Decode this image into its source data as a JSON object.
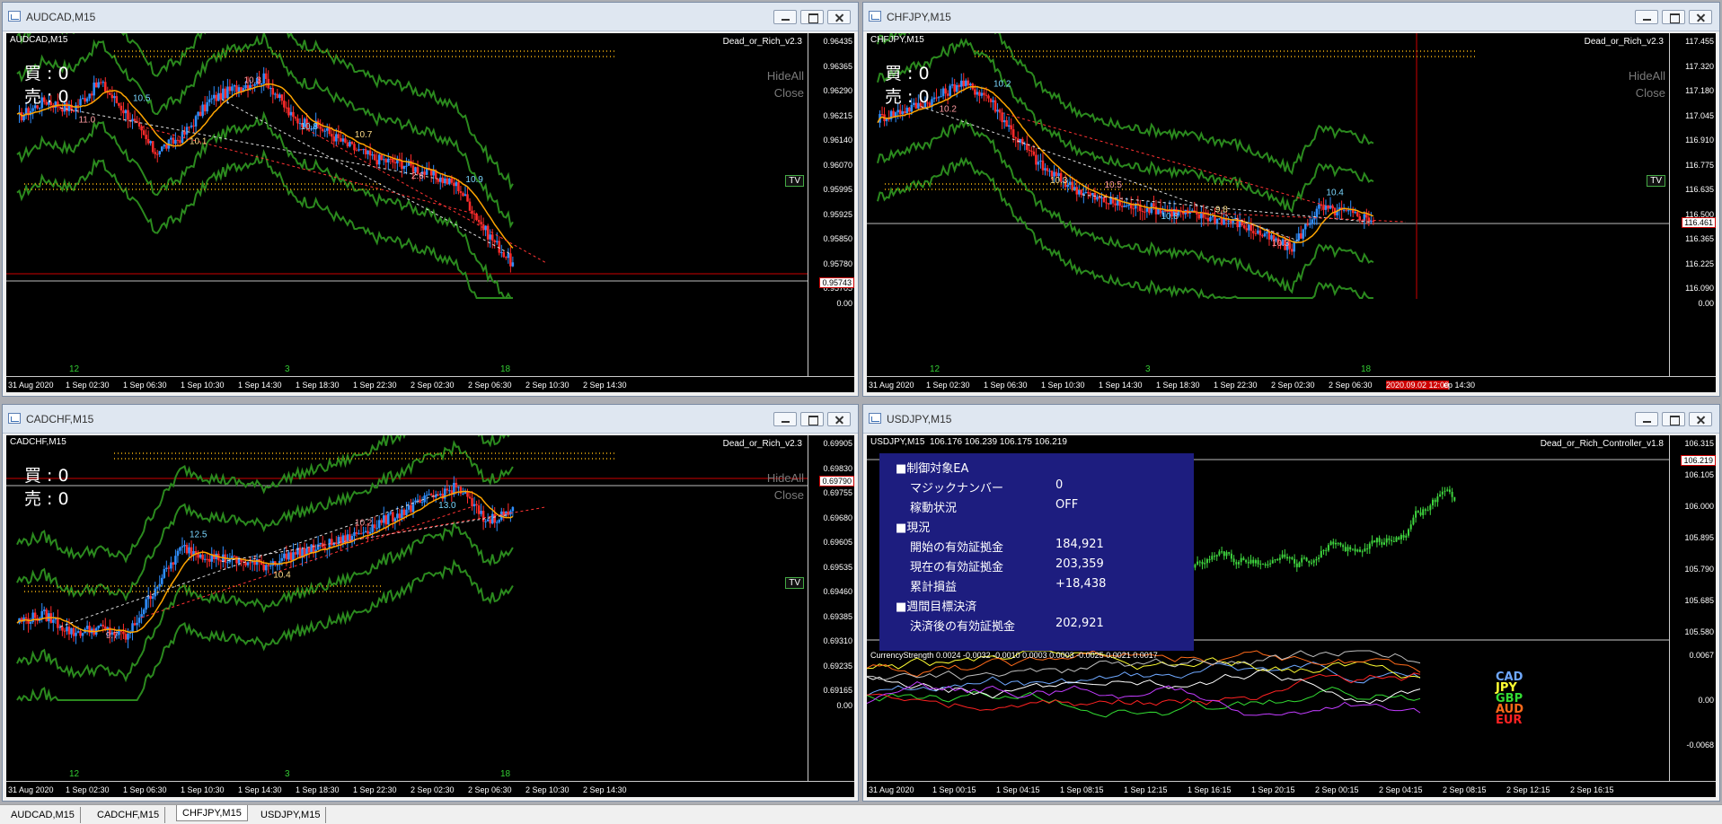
{
  "windows": [
    {
      "title": "AUDCAD,M15",
      "symbol": "AUDCAD,M15",
      "ea": "Dead_or_Rich_v2.3",
      "buy": "買 : 0",
      "sell": "売 : 0",
      "hide": "HideAll",
      "close": "Close",
      "tv": "TV",
      "prices": [
        "0.96435",
        "0.96365",
        "0.96290",
        "0.96215",
        "0.96140",
        "0.96070",
        "0.95995",
        "0.95925",
        "0.95850",
        "0.95780",
        "0.95705",
        "0.00"
      ],
      "current": "0.95743",
      "times": [
        "31 Aug 2020",
        "1 Sep 02:30",
        "1 Sep 06:30",
        "1 Sep 10:30",
        "1 Sep 14:30",
        "1 Sep 18:30",
        "1 Sep 22:30",
        "2 Sep 02:30",
        "2 Sep 06:30",
        "2 Sep 10:30",
        "2 Sep 14:30"
      ],
      "days": [
        "12",
        "3",
        "18"
      ],
      "labels": [
        "11.0",
        "10.5",
        "10.1",
        "10.3",
        "10.8",
        "10.7",
        "2.6",
        "10.9"
      ]
    },
    {
      "title": "CHFJPY,M15",
      "symbol": "CHFJPY,M15",
      "ea": "Dead_or_Rich_v2.3",
      "buy": "買 : 0",
      "sell": "売 : 0",
      "hide": "HideAll",
      "close": "Close",
      "tv": "TV",
      "prices": [
        "117.455",
        "117.320",
        "117.180",
        "117.045",
        "116.910",
        "116.775",
        "116.635",
        "116.500",
        "116.365",
        "116.225",
        "116.090",
        "0.00"
      ],
      "current": "116.461",
      "times": [
        "31 Aug 2020",
        "1 Sep 02:30",
        "1 Sep 06:30",
        "1 Sep 10:30",
        "1 Sep 14:30",
        "1 Sep 18:30",
        "1 Sep 22:30",
        "2 Sep 02:30",
        "2 Sep 06:30",
        "2020.09.02 12:00",
        "ep 14:30"
      ],
      "days": [
        "12",
        "3",
        "18"
      ],
      "labels": [
        "10.2",
        "10.2",
        "10.3",
        "10.5",
        "10.8",
        "9.8",
        "10.3",
        "10.4"
      ]
    },
    {
      "title": "CADCHF,M15",
      "symbol": "CADCHF,M15",
      "ea": "Dead_or_Rich_v2.3",
      "buy": "買 : 0",
      "sell": "売 : 0",
      "hide": "HideAll",
      "close": "Close",
      "tv": "TV",
      "prices": [
        "0.69905",
        "0.69830",
        "0.69755",
        "0.69680",
        "0.69605",
        "0.69535",
        "0.69460",
        "0.69385",
        "0.69310",
        "0.69235",
        "0.69165",
        "0.00"
      ],
      "current": "0.69790",
      "times": [
        "31 Aug 2020",
        "1 Sep 02:30",
        "1 Sep 06:30",
        "1 Sep 10:30",
        "1 Sep 14:30",
        "1 Sep 18:30",
        "1 Sep 22:30",
        "2 Sep 02:30",
        "2 Sep 06:30",
        "2 Sep 10:30",
        "2 Sep 14:30"
      ],
      "days": [
        "12",
        "3",
        "18"
      ],
      "labels": [
        "9.7",
        "12.5",
        "10.4",
        "10.2",
        "13.0"
      ]
    },
    {
      "title": "USDJPY,M15",
      "symbol": "USDJPY,M15",
      "quote": "106.176 106.239 106.175 106.219",
      "ea": "Dead_or_Rich_Controller_v1.8",
      "prices": [
        "106.315",
        "106.105",
        "106.000",
        "105.895",
        "105.790",
        "105.685",
        "105.580"
      ],
      "current": "106.219",
      "indicator": "CurrencyStrength 0.0024 -0.0032 -0.0010 0.0003 0.0003 -0.0025 0.0021 0.0017",
      "ind_axis": [
        "0.0067",
        "0.00",
        "-0.0068"
      ],
      "times": [
        "31 Aug 2020",
        "1 Sep 00:15",
        "1 Sep 04:15",
        "1 Sep 08:15",
        "1 Sep 12:15",
        "1 Sep 16:15",
        "1 Sep 20:15",
        "2 Sep 00:15",
        "2 Sep 04:15",
        "2 Sep 08:15",
        "2 Sep 12:15",
        "2 Sep 16:15"
      ],
      "currencies": [
        {
          "name": "CAD",
          "color": "#6fa8ff"
        },
        {
          "name": "JPY",
          "color": "#ffff33"
        },
        {
          "name": "GBP",
          "color": "#33dd33"
        },
        {
          "name": "AUD",
          "color": "#ff6a1a"
        },
        {
          "name": "EUR",
          "color": "#ff2222"
        }
      ]
    }
  ],
  "controller": {
    "h1": "■制御対象EA",
    "magic_label": "マジックナンバー",
    "magic": "0",
    "status_label": "稼動状況",
    "status": "OFF",
    "h2": "■現況",
    "start_label": "開始の有効証拠金",
    "start": "184,921",
    "now_label": "現在の有効証拠金",
    "now": "203,359",
    "pl_label": "累計損益",
    "pl": "+18,438",
    "h3": "■週間目標決済",
    "after_label": "決済後の有効証拠金",
    "after": "202,921"
  },
  "tabs": [
    "AUDCAD,M15",
    "CADCHF,M15",
    "CHFJPY,M15",
    "USDJPY,M15"
  ],
  "active_tab": "CHFJPY,M15"
}
